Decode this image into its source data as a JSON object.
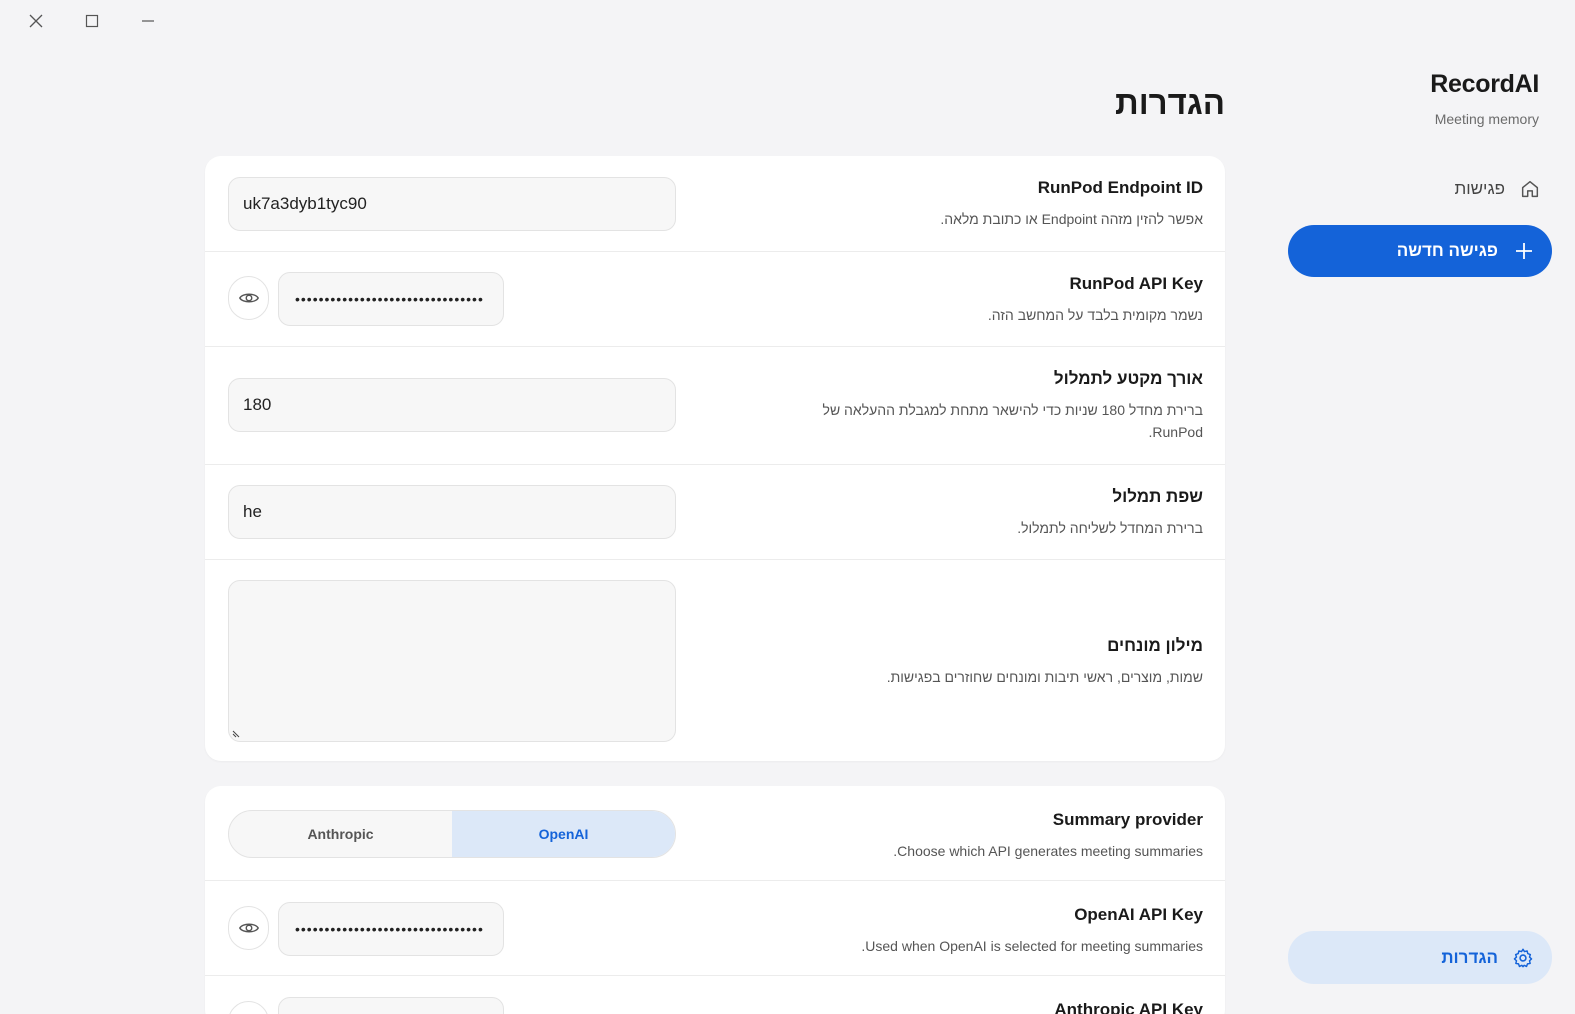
{
  "window": {
    "close_icon": "close-icon",
    "maximize_icon": "maximize-icon",
    "minimize_icon": "minimize-icon"
  },
  "sidebar": {
    "brand_title": "RecordAI",
    "brand_subtitle": "Meeting memory",
    "nav_meetings_label": "פגישות",
    "new_meeting_label": "פגישה חדשה",
    "settings_label": "הגדרות",
    "accent_color": "#1463d9"
  },
  "main": {
    "title": "הגדרות",
    "transcription_card": {
      "endpoint": {
        "title": "RunPod Endpoint ID",
        "description": "אפשר להזין מזהה Endpoint או כתובת מלאה.",
        "value": "uk7a3dyb1tyc90"
      },
      "runpod_key": {
        "title": "RunPod API Key",
        "description": "נשמר מקומית בלבד על המחשב הזה.",
        "value": "••••••••••••••••••••••••••••••••"
      },
      "segment_length": {
        "title": "אורך מקטע לתמלול",
        "description": "ברירת מחדל 180 שניות כדי להישאר מתחת למגבלת ההעלאה של RunPod.",
        "value": "180"
      },
      "language": {
        "title": "שפת תמלול",
        "description": "ברירת המחדל לשליחה לתמלול.",
        "value": "he"
      },
      "glossary": {
        "title": "מילון מונחים",
        "description": "שמות, מוצרים, ראשי תיבות ומונחים שחוזרים בפגישות.",
        "value": ""
      }
    },
    "summary_card": {
      "provider": {
        "title": "Summary provider",
        "description": "Choose which API generates meeting summaries.",
        "options": [
          "Anthropic",
          "OpenAI"
        ],
        "selected": "OpenAI"
      },
      "openai_key": {
        "title": "OpenAI API Key",
        "description": "Used when OpenAI is selected for meeting summaries.",
        "value": "••••••••••••••••••••••••••••••••"
      },
      "anthropic_key": {
        "title": "Anthropic API Key"
      }
    }
  }
}
